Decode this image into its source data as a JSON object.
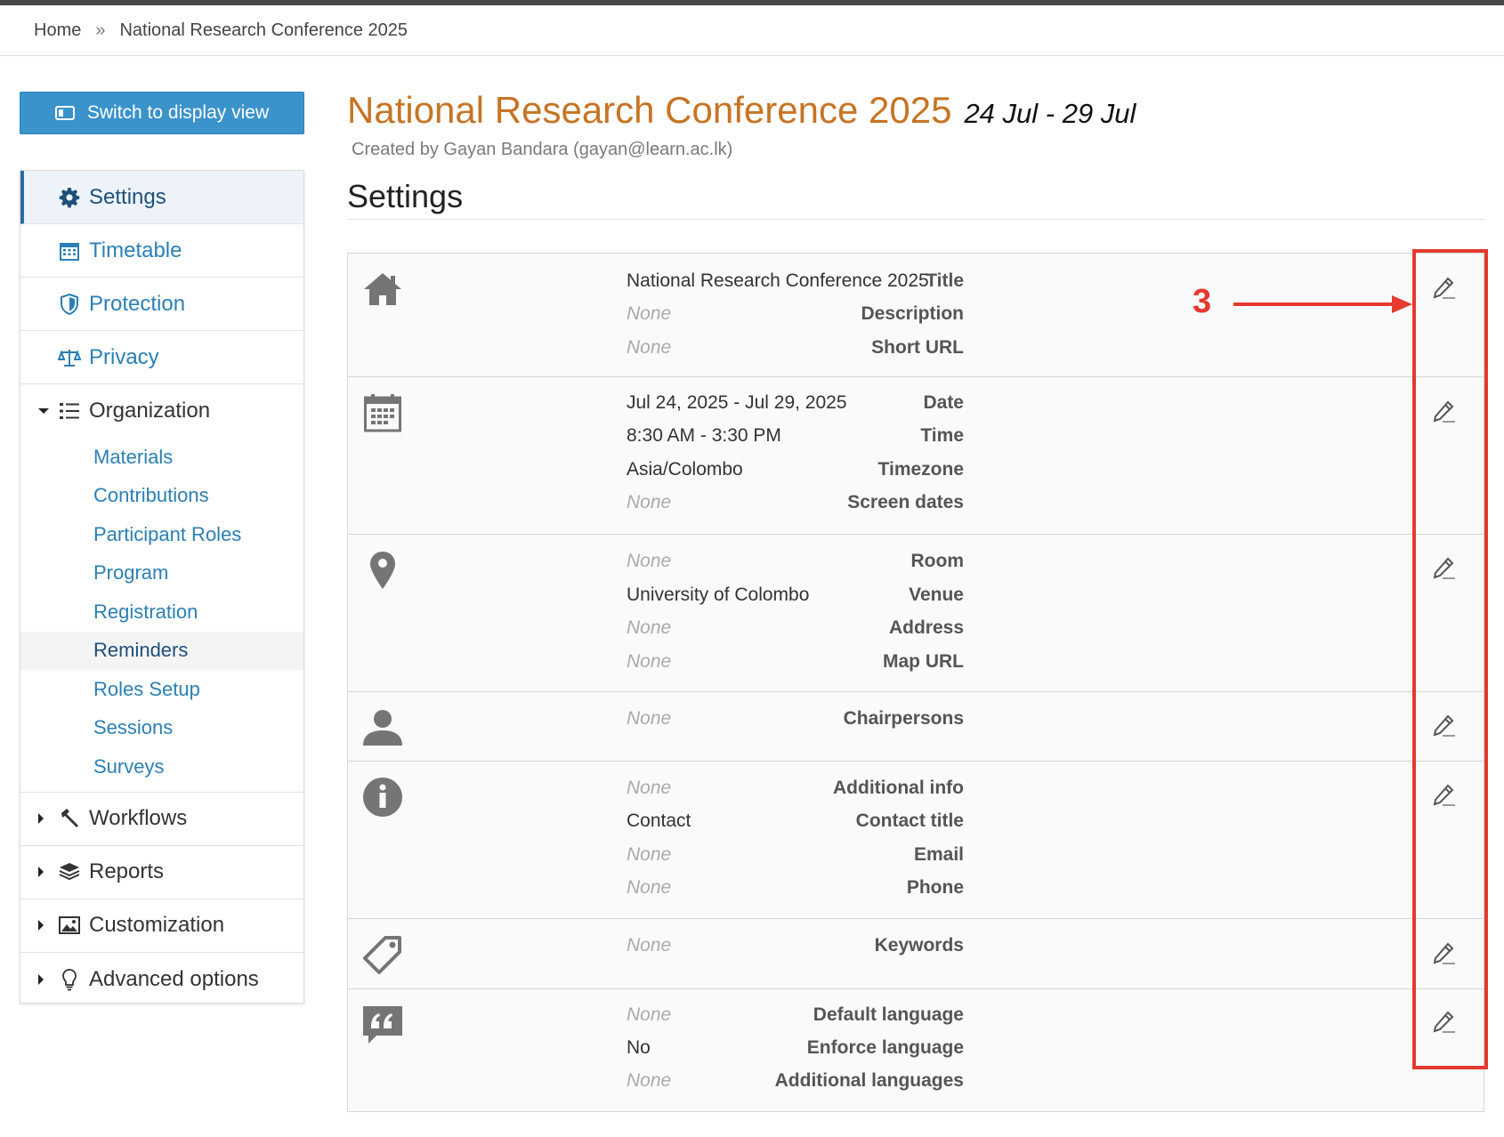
{
  "breadcrumb": {
    "home": "Home",
    "separator": "»",
    "current": "National Research Conference 2025"
  },
  "switch_button": {
    "label": "Switch to display view"
  },
  "sidebar": {
    "items": [
      {
        "label": "Settings",
        "icon": "gear-icon",
        "active": true
      },
      {
        "label": "Timetable",
        "icon": "calendar-grid-icon"
      },
      {
        "label": "Protection",
        "icon": "shield-icon"
      },
      {
        "label": "Privacy",
        "icon": "scales-icon"
      },
      {
        "label": "Organization",
        "icon": "list-icon",
        "expanded": true
      },
      {
        "label": "Workflows",
        "icon": "hammer-icon"
      },
      {
        "label": "Reports",
        "icon": "layers-icon"
      },
      {
        "label": "Customization",
        "icon": "image-icon"
      },
      {
        "label": "Advanced options",
        "icon": "lightbulb-icon"
      }
    ],
    "organization_sub": [
      "Materials",
      "Contributions",
      "Participant Roles",
      "Program",
      "Registration",
      "Reminders",
      "Roles Setup",
      "Sessions",
      "Surveys"
    ],
    "highlighted_sub": "Reminders"
  },
  "event": {
    "title": "National Research Conference 2025",
    "dates": "24 Jul - 29 Jul",
    "created_by": "Created by Gayan Bandara (gayan@learn.ac.lk)"
  },
  "page": {
    "section_title": "Settings"
  },
  "rows": {
    "general": {
      "title": {
        "key": "Title",
        "value": "National Research Conference 2025"
      },
      "description": {
        "key": "Description",
        "value": "None"
      },
      "short_url": {
        "key": "Short URL",
        "value": "None"
      }
    },
    "dates": {
      "date": {
        "key": "Date",
        "value": "Jul 24, 2025 - Jul 29, 2025"
      },
      "time": {
        "key": "Time",
        "value": "8:30 AM - 3:30 PM"
      },
      "timezone": {
        "key": "Timezone",
        "value": "Asia/Colombo"
      },
      "screen_dates": {
        "key": "Screen dates",
        "value": "None"
      }
    },
    "location": {
      "room": {
        "key": "Room",
        "value": "None"
      },
      "venue": {
        "key": "Venue",
        "value": "University of Colombo"
      },
      "address": {
        "key": "Address",
        "value": "None"
      },
      "map_url": {
        "key": "Map URL",
        "value": "None"
      }
    },
    "persons": {
      "chairpersons": {
        "key": "Chairpersons",
        "value": "None"
      }
    },
    "contact": {
      "additional_info": {
        "key": "Additional info",
        "value": "None"
      },
      "contact_title": {
        "key": "Contact title",
        "value": "Contact"
      },
      "email": {
        "key": "Email",
        "value": "None"
      },
      "phone": {
        "key": "Phone",
        "value": "None"
      }
    },
    "classification": {
      "keywords": {
        "key": "Keywords",
        "value": "None"
      }
    },
    "languages": {
      "default_language": {
        "key": "Default language",
        "value": "None"
      },
      "enforce_language": {
        "key": "Enforce language",
        "value": "No"
      },
      "additional_languages": {
        "key": "Additional languages",
        "value": "None"
      }
    }
  },
  "annotation": {
    "number": "3",
    "color": "#e53a2e"
  },
  "colors": {
    "accent": "#3b93cc",
    "title": "#c77423",
    "link": "#2b7fb5"
  }
}
